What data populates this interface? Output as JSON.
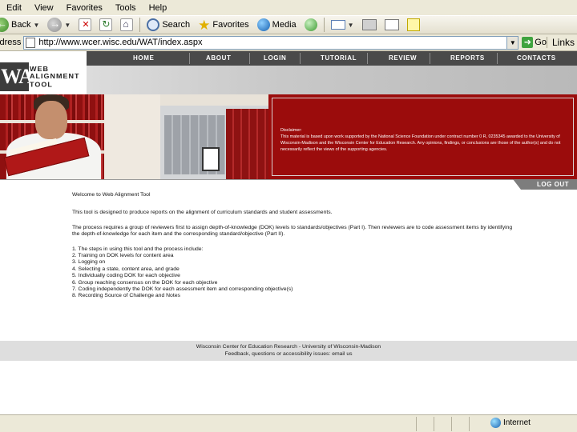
{
  "browser": {
    "menu": [
      "Edit",
      "View",
      "Favorites",
      "Tools",
      "Help"
    ],
    "toolbar": {
      "back_label": "Back",
      "search_label": "Search",
      "favorites_label": "Favorites",
      "media_label": "Media"
    },
    "address": {
      "label": "Address",
      "url": "http://www.wcer.wisc.edu/WAT/index.aspx",
      "go_label": "Go",
      "links_label": "Links"
    },
    "status": {
      "zone": "Internet"
    }
  },
  "site": {
    "logo": {
      "mark": "WAT",
      "line1": "WEB ALIGNMENT",
      "line2": "TOOL"
    },
    "nav": [
      "HOME",
      "ABOUT",
      "LOGIN",
      "TUTORIAL",
      "REVIEW",
      "REPORTS",
      "CONTACTS"
    ],
    "disclaimer_heading": "Disclaimer:",
    "disclaimer_text": "This material is based upon work supported by the National Science Foundation under contract number 0 R, 0235345 awarded to the University of Wisconsin-Madison and the Wisconsin Center for Education Research. Any opinions, findings, or conclusions are those of the author(s) and do not necessarily reflect the views of the supporting agencies.",
    "logout_label": "LOG OUT",
    "welcome": "Welcome to Web Alignment Tool",
    "intro": "This tool is designed to produce reports on the alignment of curriculum standards and student assessments.",
    "process": "The process requires a group of reviewers first to assign depth-of-knowledge (DOK) levels to standards/objectives (Part I). Then reviewers are to code assessment items by identifying the depth-of-knowledge for each item and the corresponding standard/objective (Part II).",
    "steps": [
      "1. The steps in using this tool and the process include:",
      "2. Training on DOK levels for content area",
      "3. Logging on",
      "4. Selecting a state, content area, and grade",
      "5. Individually coding DOK for each objective",
      "6. Group reaching consensus on the DOK for each objective",
      "7. Coding independently the DOK for each assessment item and corresponding objective(s)",
      "8. Recording Source of Challenge and Notes"
    ],
    "footer_line1": "Wisconsin Center for Education Research  -  University of Wisconsin-Madison",
    "footer_line2": "Feedback, questions or accessibility issues: email us"
  }
}
